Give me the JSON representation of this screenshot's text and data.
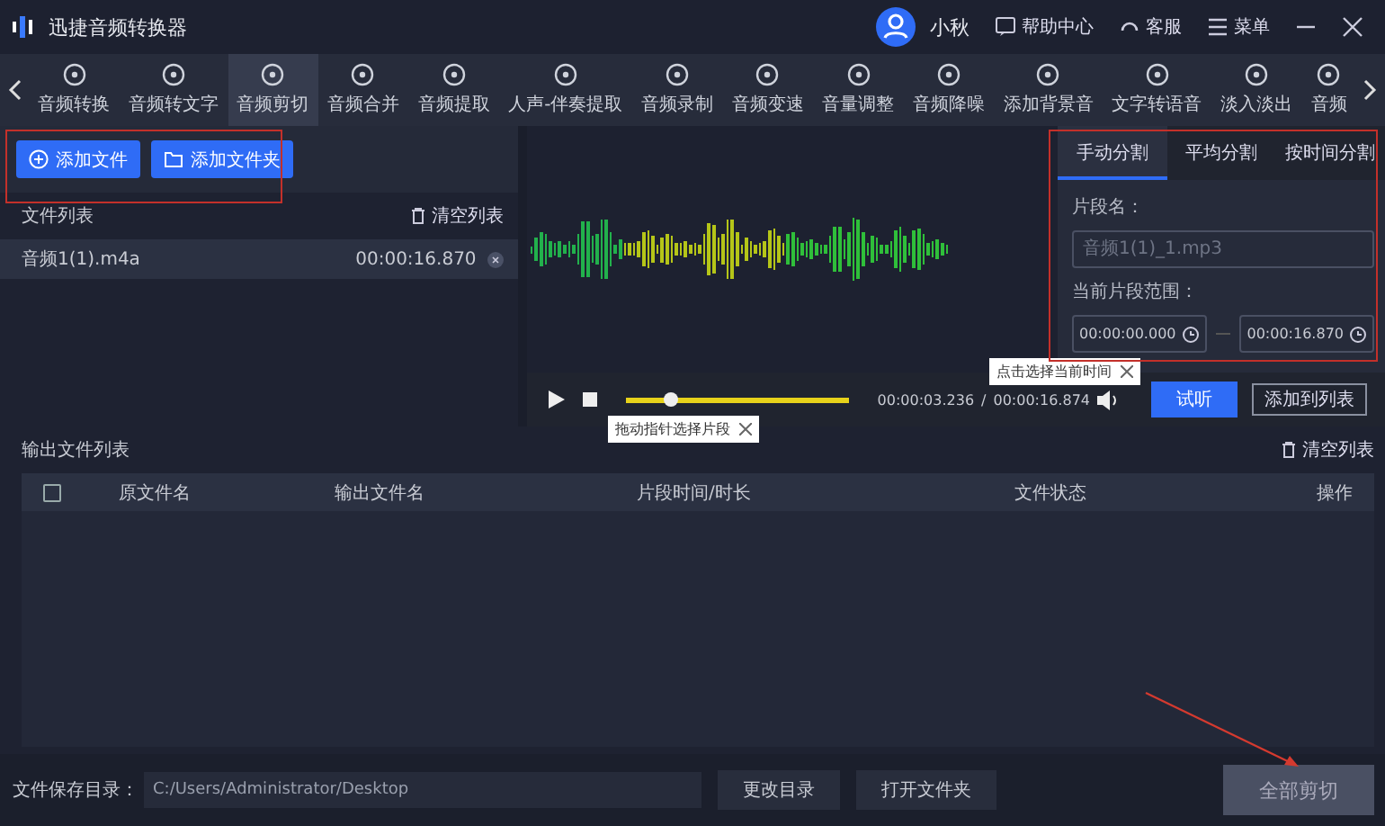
{
  "window": {
    "title": "迅捷音频转换器",
    "user": "小秋",
    "actions": [
      "帮助中心",
      "客服",
      "菜单"
    ]
  },
  "toolbar": [
    {
      "label": "音频转换",
      "selected": false
    },
    {
      "label": "音频转文字",
      "selected": false
    },
    {
      "label": "音频剪切",
      "selected": true
    },
    {
      "label": "音频合并",
      "selected": false
    },
    {
      "label": "音频提取",
      "selected": false
    },
    {
      "label": "人声-伴奏提取",
      "selected": false
    },
    {
      "label": "音频录制",
      "selected": false
    },
    {
      "label": "音频变速",
      "selected": false
    },
    {
      "label": "音量调整",
      "selected": false
    },
    {
      "label": "音频降噪",
      "selected": false
    },
    {
      "label": "添加背景音",
      "selected": false
    },
    {
      "label": "文字转语音",
      "selected": false
    },
    {
      "label": "淡入淡出",
      "selected": false
    },
    {
      "label": "音频",
      "selected": false
    }
  ],
  "add_buttons": [
    "添加文件",
    "添加文件夹"
  ],
  "file_list": {
    "title": "文件列表",
    "clear": "清空列表",
    "files": [
      {
        "name": "音频1(1).m4a",
        "duration": "00:00:16.870",
        "selected": true
      }
    ]
  },
  "split_panel": {
    "tabs": [
      {
        "label": "手动分割",
        "selected": true
      },
      {
        "label": "平均分割",
        "selected": false
      },
      {
        "label": "按时间分割",
        "selected": false
      }
    ],
    "name_label": "片段名：",
    "name_placeholder": "音频1(1)_1.mp3",
    "range_label": "当前片段范围：",
    "range_start": "00:00:00.000",
    "range_end": "00:00:16.870",
    "tooltip": "点击选择当前时间"
  },
  "player": {
    "level": 0.19,
    "current": "00:00:03.236",
    "separator": "/",
    "total": "00:00:16.874",
    "tooltip": "拖动指针选择片段",
    "preview": "试听",
    "add_to_list": "添加到列表"
  },
  "output": {
    "title": "输出文件列表",
    "clear": "清空列表",
    "checked": false,
    "columns": [
      "原文件名",
      "输出文件名",
      "片段时间/时长",
      "文件状态",
      "操作"
    ]
  },
  "footer": {
    "label": "文件保存目录：",
    "path": "C:/Users/Administrator/Desktop",
    "change": "更改目录",
    "open": "打开文件夹",
    "cut_all": "全部剪切",
    "cut_all_disabled": true
  }
}
